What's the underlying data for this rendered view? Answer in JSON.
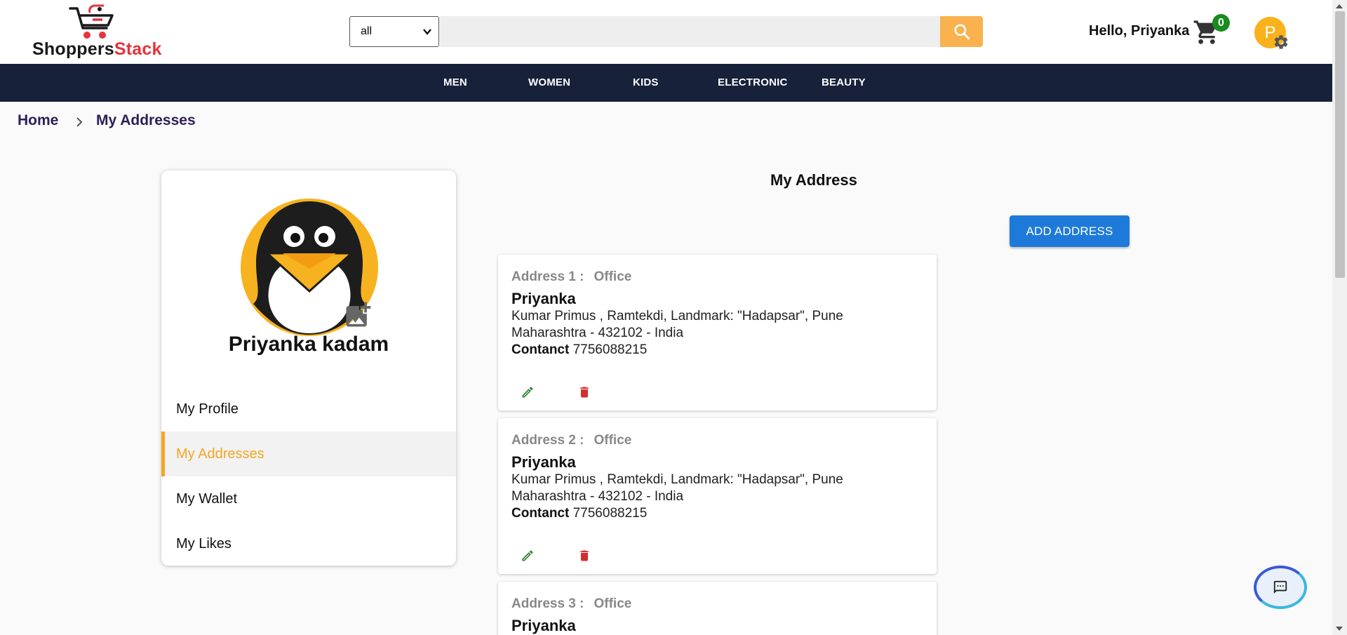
{
  "brand": {
    "part1": "Shoppers",
    "part2": "Stack",
    "accent": "#e8323c"
  },
  "search": {
    "category_selected": "all",
    "placeholder": ""
  },
  "user": {
    "greeting": "Hello, Priyanka",
    "cart_count": "0",
    "avatar_initial": "P"
  },
  "nav": {
    "items": [
      "MEN",
      "WOMEN",
      "KIDS",
      "ELECTRONIC",
      "BEAUTY"
    ]
  },
  "breadcrumb": {
    "home": "Home",
    "current": "My Addresses"
  },
  "profile": {
    "name": "Priyanka kadam",
    "menu": [
      "My Profile",
      "My Addresses",
      "My Wallet",
      "My Likes"
    ],
    "active_item": "My Addresses"
  },
  "main": {
    "title": "My Address",
    "add_button": "ADD ADDRESS",
    "addresses": [
      {
        "label": "Address 1 :",
        "type": "Office",
        "name": "Priyanka",
        "line1": "Kumar Primus , Ramtekdi, Landmark: \"Hadapsar\", Pune",
        "line2": "Maharashtra - 432102 - India",
        "contact_label": "Contanct",
        "contact": "7756088215"
      },
      {
        "label": "Address 2 :",
        "type": "Office",
        "name": "Priyanka",
        "line1": "Kumar Primus , Ramtekdi, Landmark: \"Hadapsar\", Pune",
        "line2": "Maharashtra - 432102 - India",
        "contact_label": "Contanct",
        "contact": "7756088215"
      },
      {
        "label": "Address 3 :",
        "type": "Office",
        "name": "Priyanka"
      }
    ]
  },
  "colors": {
    "navbar": "#17213a",
    "accent_orange": "#f5a623",
    "primary_blue": "#1e7ad8",
    "edit_green": "#2e7d32",
    "delete_red": "#d32f2f"
  }
}
